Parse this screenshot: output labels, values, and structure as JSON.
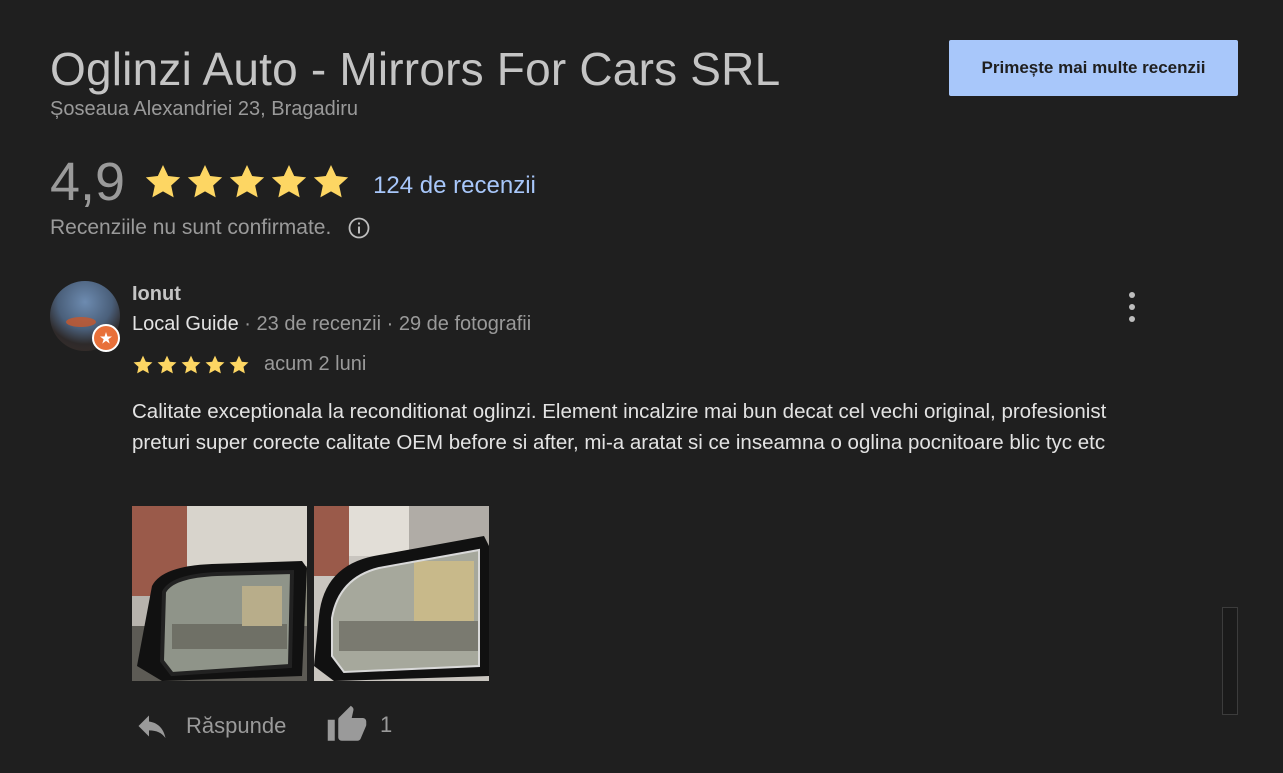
{
  "business": {
    "name": "Oglinzi Auto - Mirrors For Cars SRL",
    "address": "Șoseaua Alexandriei 23, Bragadiru"
  },
  "header": {
    "more_reviews_button": "Primește mai multe recenzii"
  },
  "rating": {
    "value": "4,9",
    "stars": 5,
    "reviews_count_link": "124 de recenzii",
    "unconfirmed_note": "Recenziile nu sunt confirmate."
  },
  "review": {
    "reviewer_name": "Ionut",
    "badge": "Local Guide",
    "reviews_count": "23 de recenzii",
    "photos_count": "29 de fotografii",
    "separator": " · ",
    "stars": 5,
    "date": "acum 2 luni",
    "text": "Calitate exceptionala la reconditionat oglinzi. Element incalzire mai bun decat cel vechi original, profesionist preturi super corecte calitate OEM before si after, mi-a aratat si ce inseamna o oglina pocnitoare blic tyc etc",
    "reply_label": "Răspunde",
    "likes": "1"
  },
  "colors": {
    "background": "#1f1f1f",
    "accent": "#a8c7fa",
    "star": "#fdd663",
    "muted_text": "#9a9a9a"
  },
  "icons": [
    "star-icon",
    "info-icon",
    "more-vert-icon",
    "reply-icon",
    "thumb-up-icon",
    "local-guide-badge-icon"
  ]
}
